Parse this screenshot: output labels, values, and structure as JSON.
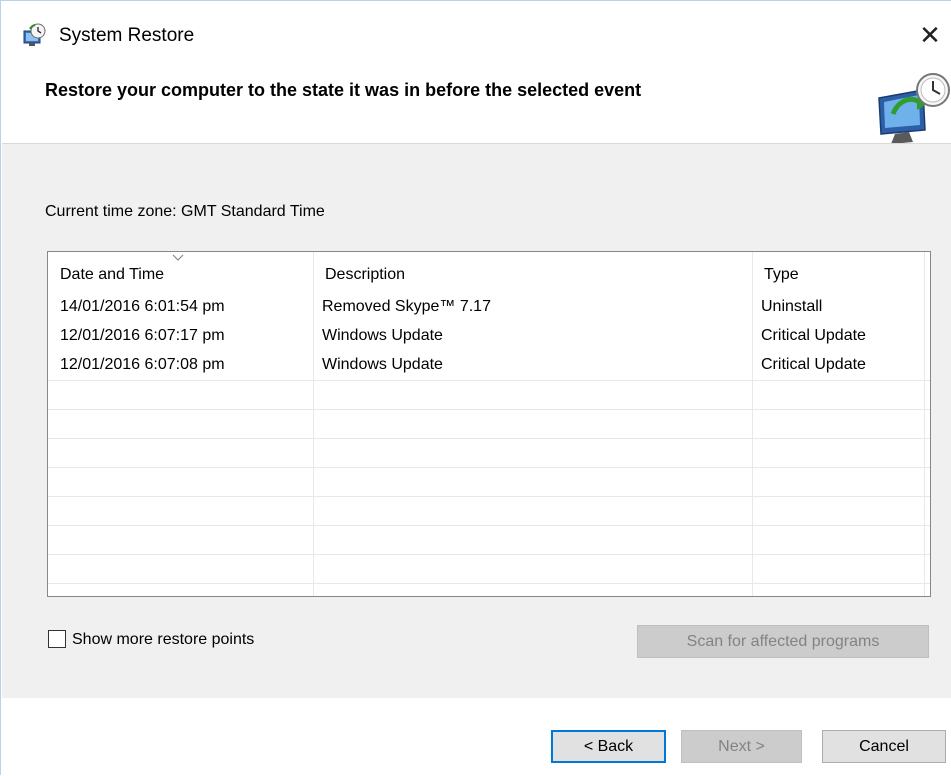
{
  "window": {
    "title": "System Restore",
    "close_glyph": "✕"
  },
  "header": {
    "heading": "Restore your computer to the state it was in before the selected event"
  },
  "content": {
    "timezone": "Current time zone: GMT Standard Time",
    "columns": [
      "Date and Time",
      "Description",
      "Type"
    ],
    "rows": [
      {
        "date": "14/01/2016 6:01:54 pm",
        "description": "Removed Skype™ 7.17",
        "type": "Uninstall"
      },
      {
        "date": "12/01/2016 6:07:17 pm",
        "description": "Windows Update",
        "type": "Critical Update"
      },
      {
        "date": "12/01/2016 6:07:08 pm",
        "description": "Windows Update",
        "type": "Critical Update"
      }
    ],
    "show_more_label": "Show more restore points",
    "show_more_checked": false,
    "scan_label": "Scan for affected programs"
  },
  "footer": {
    "back_label": "< Back",
    "next_label": "Next >",
    "cancel_label": "Cancel"
  },
  "icons": {
    "app": "system-restore-icon",
    "header": "system-restore-monitor-icon",
    "close": "close-icon",
    "sort": "sort-descending-icon"
  },
  "colors": {
    "content_bg": "#f0f0f0",
    "primary_border": "#0078d7",
    "disabled_text": "#838383"
  }
}
